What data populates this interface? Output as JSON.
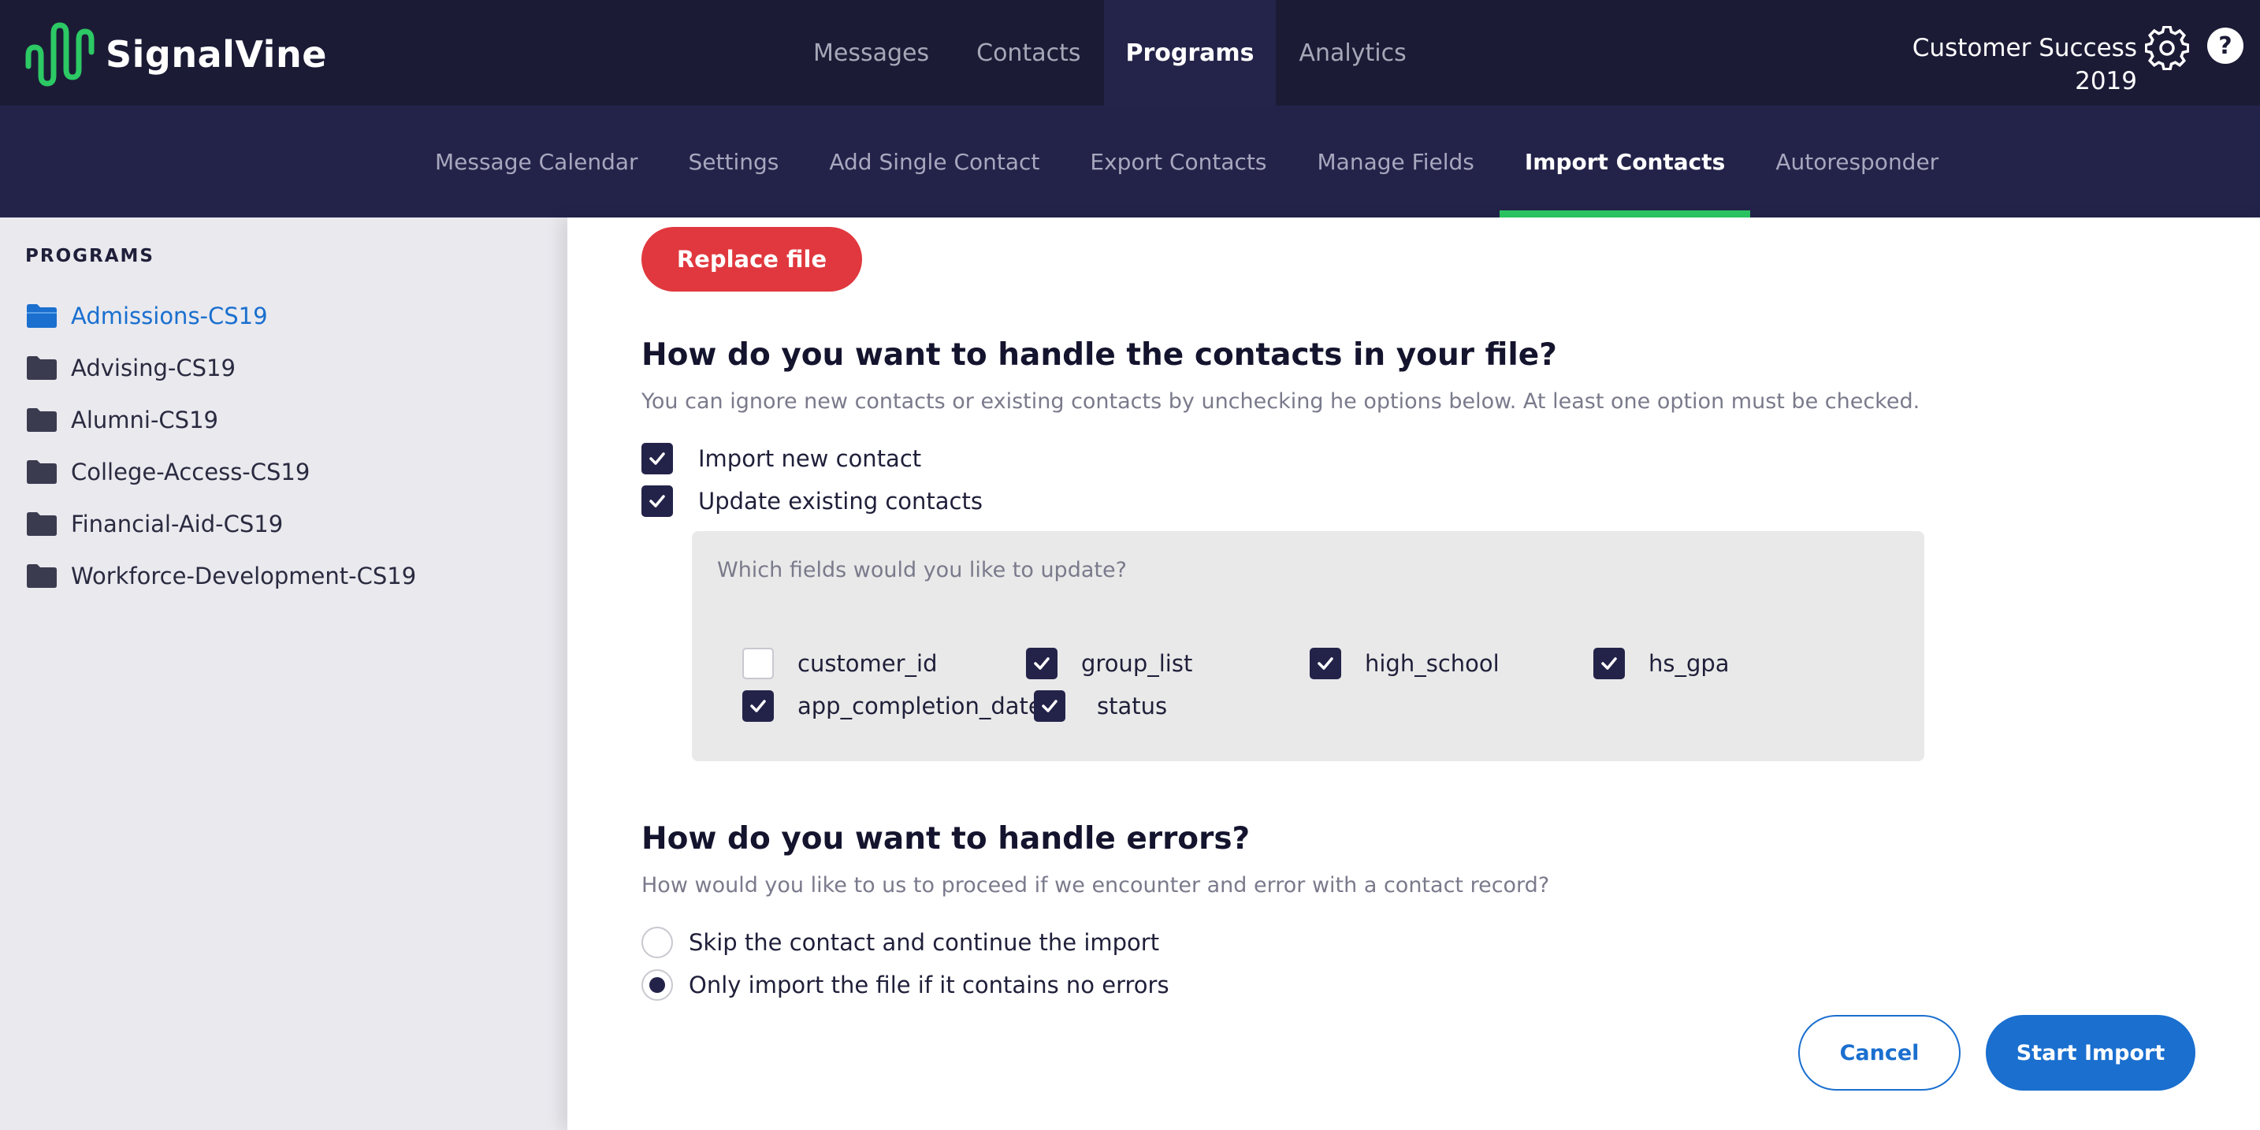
{
  "header": {
    "logo_text": "SignalVine",
    "nav": [
      {
        "label": "Messages",
        "active": false
      },
      {
        "label": "Contacts",
        "active": false
      },
      {
        "label": "Programs",
        "active": true
      },
      {
        "label": "Analytics",
        "active": false
      }
    ],
    "workspace": "Customer Success 2019",
    "icons": {
      "settings": "gear-icon",
      "help": "help-icon"
    }
  },
  "subnav": {
    "items": [
      {
        "label": "Message Calendar",
        "active": false
      },
      {
        "label": "Settings",
        "active": false
      },
      {
        "label": "Add Single Contact",
        "active": false
      },
      {
        "label": "Export Contacts",
        "active": false
      },
      {
        "label": "Manage Fields",
        "active": false
      },
      {
        "label": "Import Contacts",
        "active": true
      },
      {
        "label": "Autoresponder",
        "active": false
      }
    ]
  },
  "sidebar": {
    "heading": "PROGRAMS",
    "items": [
      {
        "label": "Admissions-CS19",
        "active": true,
        "icon": "folder-open-icon"
      },
      {
        "label": "Advising-CS19",
        "active": false,
        "icon": "folder-icon"
      },
      {
        "label": "Alumni-CS19",
        "active": false,
        "icon": "folder-icon"
      },
      {
        "label": "College-Access-CS19",
        "active": false,
        "icon": "folder-icon"
      },
      {
        "label": "Financial-Aid-CS19",
        "active": false,
        "icon": "folder-icon"
      },
      {
        "label": "Workforce-Development-CS19",
        "active": false,
        "icon": "folder-icon"
      }
    ]
  },
  "main": {
    "replace_button": "Replace file",
    "contacts_section": {
      "title": "How do you want to handle the contacts in your file?",
      "description": "You can ignore new contacts or existing contacts by unchecking he options below. At least one option must be checked.",
      "options": [
        {
          "label": "Import new contact",
          "checked": true
        },
        {
          "label": "Update existing contacts",
          "checked": true
        }
      ],
      "fields_prompt": "Which fields would you like to update?",
      "fields": [
        {
          "label": "customer_id",
          "checked": false
        },
        {
          "label": "group_list",
          "checked": true
        },
        {
          "label": "high_school",
          "checked": true
        },
        {
          "label": "hs_gpa",
          "checked": true
        },
        {
          "label": "app_completion_date",
          "checked": true
        },
        {
          "label": "status",
          "checked": true
        }
      ]
    },
    "errors_section": {
      "title": "How do you want to handle errors?",
      "description": "How would you like to us to proceed if we encounter and error with a contact record?",
      "options": [
        {
          "label": "Skip the contact and continue the import",
          "selected": false
        },
        {
          "label": "Only import the file if it contains no errors",
          "selected": true
        }
      ]
    },
    "cancel_button": "Cancel",
    "start_button": "Start Import"
  },
  "colors": {
    "topbar": "#1b1b36",
    "subnav": "#23234a",
    "active_tab_indicator": "#2cc964",
    "danger": "#e0383e",
    "primary": "#1a6fcf",
    "checkbox": "#23234a"
  }
}
